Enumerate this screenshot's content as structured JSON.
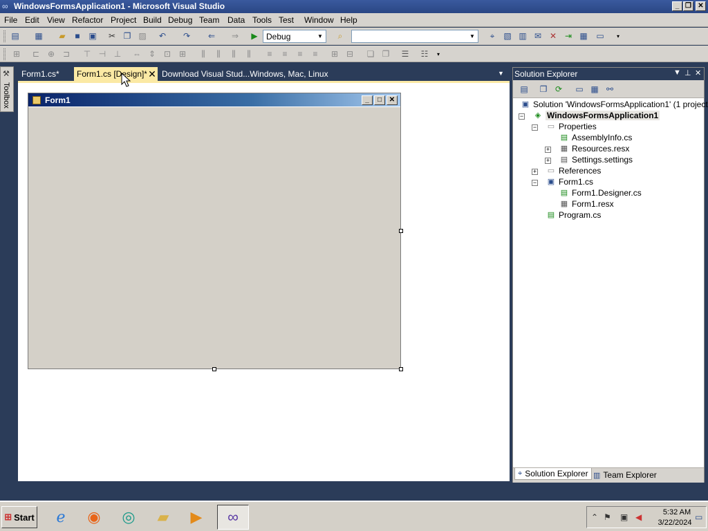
{
  "window": {
    "title": "WindowsFormsApplication1 - Microsoft Visual Studio",
    "app_icon": "infinity-icon"
  },
  "menu": [
    "File",
    "Edit",
    "View",
    "Refactor",
    "Project",
    "Build",
    "Debug",
    "Team",
    "Data",
    "Tools",
    "Test",
    "Window",
    "Help"
  ],
  "toolbar": {
    "config_value": "Debug",
    "platform_value": ""
  },
  "toolbox": {
    "label": "Toolbox"
  },
  "tabs": [
    {
      "label": "Form1.cs*",
      "active": false
    },
    {
      "label": "Form1.cs [Design]*",
      "active": true
    },
    {
      "label": "Download Visual Stud...Windows, Mac, Linux",
      "active": false
    }
  ],
  "form": {
    "title": "Form1"
  },
  "solution_explorer": {
    "title": "Solution Explorer",
    "tree": [
      {
        "label": "Solution 'WindowsFormsApplication1' (1 project)",
        "icon": "solution-icon"
      },
      {
        "label": "WindowsFormsApplication1",
        "icon": "csharp-project-icon"
      },
      {
        "label": "Properties",
        "icon": "folder-icon"
      },
      {
        "label": "AssemblyInfo.cs",
        "icon": "cs-file-icon"
      },
      {
        "label": "Resources.resx",
        "icon": "resx-file-icon"
      },
      {
        "label": "Settings.settings",
        "icon": "settings-file-icon"
      },
      {
        "label": "References",
        "icon": "references-icon"
      },
      {
        "label": "Form1.cs",
        "icon": "form-icon"
      },
      {
        "label": "Form1.Designer.cs",
        "icon": "cs-file-icon"
      },
      {
        "label": "Form1.resx",
        "icon": "resx-file-icon"
      },
      {
        "label": "Program.cs",
        "icon": "cs-file-icon"
      }
    ],
    "bottom_tabs": [
      {
        "label": "Solution Explorer",
        "active": true
      },
      {
        "label": "Team Explorer",
        "active": false
      }
    ]
  },
  "taskbar": {
    "start_label": "Start",
    "apps": [
      "internet-explorer-icon",
      "firefox-icon",
      "edge-icon",
      "file-explorer-icon",
      "media-player-icon",
      "visual-studio-icon"
    ],
    "time": "5:32 AM",
    "date": "3/22/2024"
  }
}
